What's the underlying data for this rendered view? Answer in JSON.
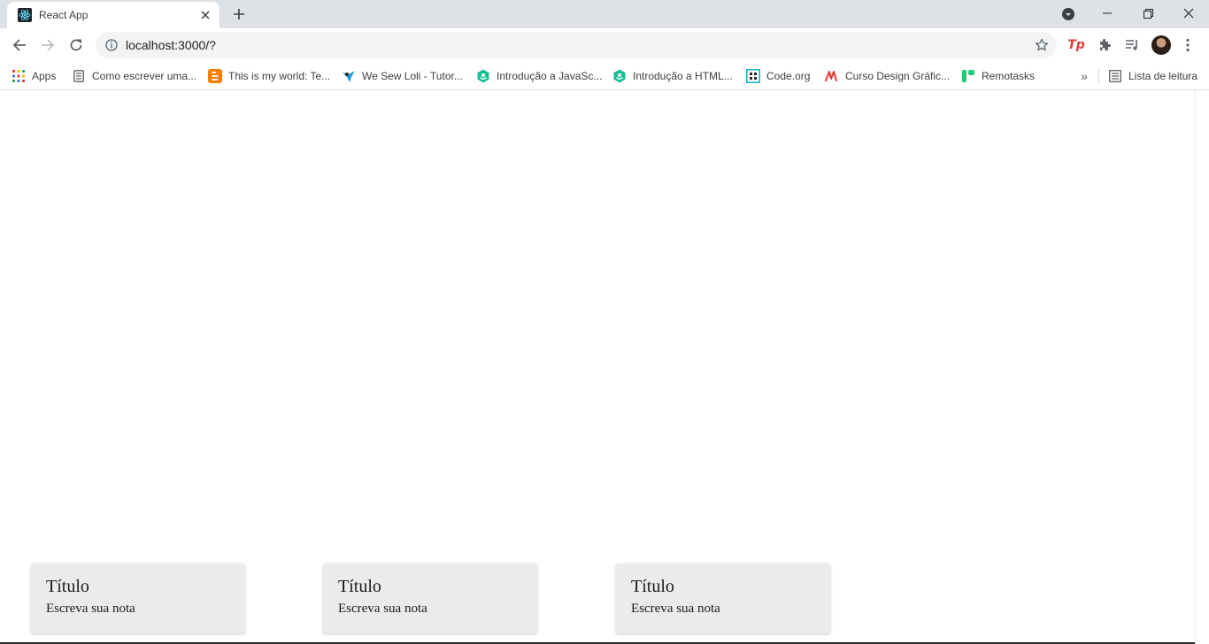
{
  "tab": {
    "title": "React App",
    "favicon": "react-icon"
  },
  "toolbar": {
    "url": "localhost:3000/?"
  },
  "bookmarks": [
    {
      "label": "Apps",
      "icon": "apps-grid-icon"
    },
    {
      "label": "Como escrever uma...",
      "icon": "document-icon"
    },
    {
      "label": "This is my world: Te...",
      "icon": "blogger-icon"
    },
    {
      "label": "We Sew Loli - Tutor...",
      "icon": "bird-icon"
    },
    {
      "label": "Introdução a JavaSc...",
      "icon": "khan-academy-icon"
    },
    {
      "label": "Introdução a HTML...",
      "icon": "khan-academy-icon"
    },
    {
      "label": "Code.org",
      "icon": "code-org-icon"
    },
    {
      "label": "Curso Design Gráfic...",
      "icon": "design-course-icon"
    },
    {
      "label": "Remotasks",
      "icon": "remotasks-icon"
    }
  ],
  "reading_list": {
    "label": "Lista de leitura"
  },
  "notes": [
    {
      "title": "Título",
      "body": "Escreva sua nota"
    },
    {
      "title": "Título",
      "body": "Escreva sua nota"
    },
    {
      "title": "Título",
      "body": "Escreva sua nota"
    }
  ],
  "colors": {
    "tabstrip_bg": "#dee1e6",
    "omnibox_bg": "#f1f3f4",
    "card_bg": "#ebebeb"
  }
}
